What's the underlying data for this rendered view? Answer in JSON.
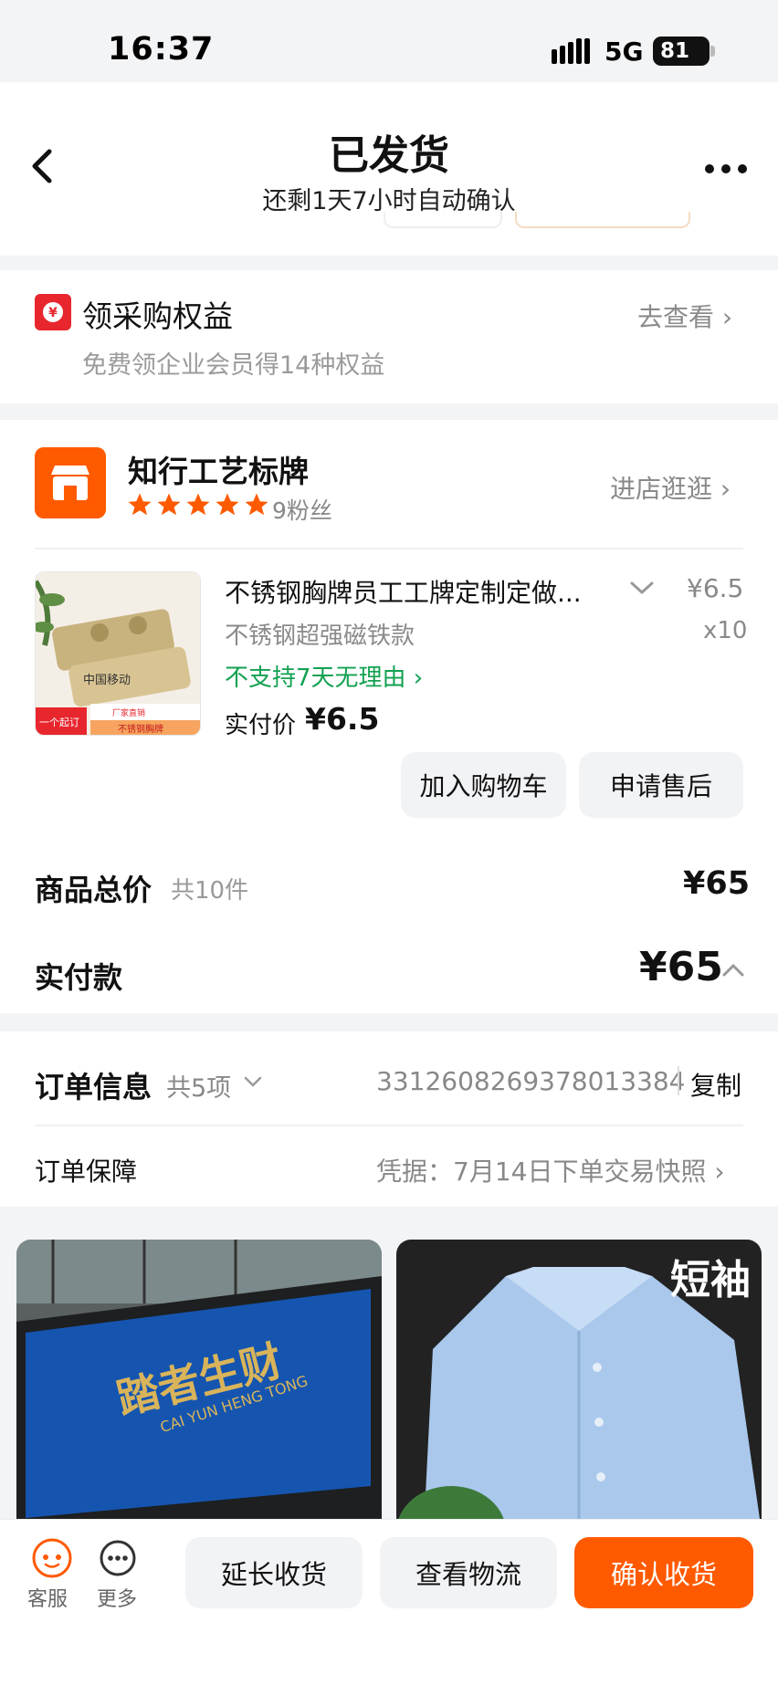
{
  "status_bar": {
    "time": "16:37",
    "network": "5G",
    "battery": "81"
  },
  "header": {
    "title": "已发货",
    "subtitle": "还剩1天7小时自动确认"
  },
  "benefit": {
    "title": "领采购权益",
    "subtitle": "免费领企业会员得14种权益",
    "link": "去查看 ›"
  },
  "shop": {
    "name": "知行工艺标牌",
    "fans": "9粉丝",
    "link": "进店逛逛 ›",
    "stars": 5
  },
  "product": {
    "title": "不锈钢胸牌员工工牌定制定做...",
    "price": "¥6.5",
    "spec": "不锈钢超强磁铁款",
    "qty": "x10",
    "return_policy": "不支持7天无理由 ›",
    "paid_label": "实付价",
    "paid_value": "¥6.5",
    "image_tags": [
      "一个起订",
      "厂家直销",
      "不锈钢胸牌"
    ],
    "btn_cart": "加入购物车",
    "btn_after_sale": "申请售后"
  },
  "totals": {
    "goods_label": "商品总价",
    "goods_count": "共10件",
    "goods_value": "¥65",
    "paid_label": "实付款",
    "paid_value": "¥65"
  },
  "order_info": {
    "label": "订单信息",
    "count": "共5项",
    "order_no": "3312608269378013384",
    "copy": "复制",
    "guarantee_label": "订单保障",
    "guarantee_link": "凭据：7月14日下单交易快照 ›"
  },
  "recommend": {
    "item1_text": "踏者生财",
    "item1_sub": "CAI YUN HENG TONG",
    "item2_text": "短袖"
  },
  "bottom_bar": {
    "service": "客服",
    "more": "更多",
    "extend": "延长收货",
    "track": "查看物流",
    "confirm": "确认收货"
  },
  "colors": {
    "accent": "#ff5a00",
    "green": "#12a150",
    "red_icon": "#e8262e"
  }
}
